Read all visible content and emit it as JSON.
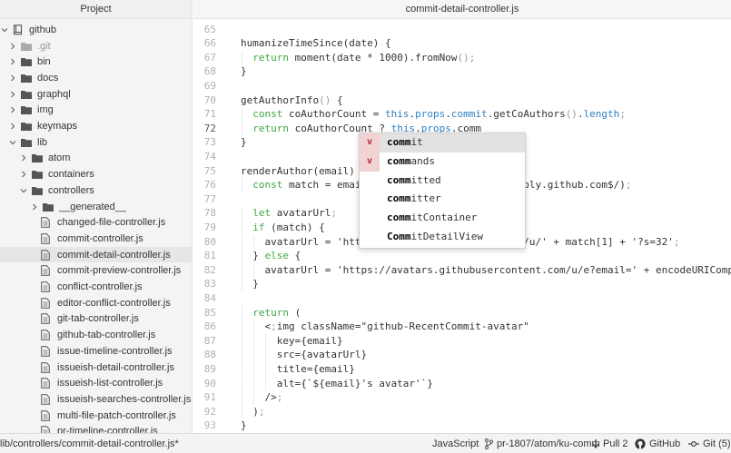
{
  "tree": {
    "header": "Project",
    "items": [
      {
        "label": "github",
        "kind": "repo",
        "open": true,
        "depth": 0
      },
      {
        "label": ".git",
        "kind": "folder",
        "open": false,
        "depth": 1,
        "dim": true
      },
      {
        "label": "bin",
        "kind": "folder",
        "open": false,
        "depth": 1
      },
      {
        "label": "docs",
        "kind": "folder",
        "open": false,
        "depth": 1
      },
      {
        "label": "graphql",
        "kind": "folder",
        "open": false,
        "depth": 1
      },
      {
        "label": "img",
        "kind": "folder",
        "open": false,
        "depth": 1
      },
      {
        "label": "keymaps",
        "kind": "folder",
        "open": false,
        "depth": 1
      },
      {
        "label": "lib",
        "kind": "folder",
        "open": true,
        "depth": 1
      },
      {
        "label": "atom",
        "kind": "folder",
        "open": false,
        "depth": 2
      },
      {
        "label": "containers",
        "kind": "folder",
        "open": false,
        "depth": 2
      },
      {
        "label": "controllers",
        "kind": "folder",
        "open": true,
        "depth": 2
      },
      {
        "label": "__generated__",
        "kind": "folder",
        "open": false,
        "depth": 3
      },
      {
        "label": "changed-file-controller.js",
        "kind": "file",
        "depth": 3
      },
      {
        "label": "commit-controller.js",
        "kind": "file",
        "depth": 3
      },
      {
        "label": "commit-detail-controller.js",
        "kind": "file",
        "depth": 3,
        "selected": true
      },
      {
        "label": "commit-preview-controller.js",
        "kind": "file",
        "depth": 3
      },
      {
        "label": "conflict-controller.js",
        "kind": "file",
        "depth": 3
      },
      {
        "label": "editor-conflict-controller.js",
        "kind": "file",
        "depth": 3
      },
      {
        "label": "git-tab-controller.js",
        "kind": "file",
        "depth": 3
      },
      {
        "label": "github-tab-controller.js",
        "kind": "file",
        "depth": 3
      },
      {
        "label": "issue-timeline-controller.js",
        "kind": "file",
        "depth": 3
      },
      {
        "label": "issueish-detail-controller.js",
        "kind": "file",
        "depth": 3
      },
      {
        "label": "issueish-list-controller.js",
        "kind": "file",
        "depth": 3
      },
      {
        "label": "issueish-searches-controller.js",
        "kind": "file",
        "depth": 3
      },
      {
        "label": "multi-file-patch-controller.js",
        "kind": "file",
        "depth": 3
      },
      {
        "label": "pr-timeline-controller.js",
        "kind": "file",
        "depth": 3
      }
    ]
  },
  "editor": {
    "tab_title": "commit-detail-controller.js",
    "cursor_line": "72",
    "lines": [
      {
        "n": "65",
        "code": ""
      },
      {
        "n": "66",
        "code": "humanizeTimeSince(date) {"
      },
      {
        "n": "67",
        "code": "  return moment(date * 1000).fromNow();"
      },
      {
        "n": "68",
        "code": "}"
      },
      {
        "n": "69",
        "code": ""
      },
      {
        "n": "70",
        "code": "getAuthorInfo() {"
      },
      {
        "n": "71",
        "code": "  const coAuthorCount = this.props.commit.getCoAuthors().length;"
      },
      {
        "n": "72",
        "code": "  return coAuthorCount ? this.props.comm"
      },
      {
        "n": "73",
        "code": "}"
      },
      {
        "n": "74",
        "code": ""
      },
      {
        "n": "75",
        "code": "renderAuthor(email) {"
      },
      {
        "n": "76",
        "code": "  const match = email                      noreply.github.com$/);"
      },
      {
        "n": "77",
        "code": ""
      },
      {
        "n": "78",
        "code": "  let avatarUrl;"
      },
      {
        "n": "79",
        "code": "  if (match) {"
      },
      {
        "n": "80",
        "code": "    avatarUrl = 'http                      .com/u/' + match[1] + '?s=32';"
      },
      {
        "n": "81",
        "code": "  } else {"
      },
      {
        "n": "82",
        "code": "    avatarUrl = 'https://avatars.githubusercontent.com/u/e?email=' + encodeURIComponent"
      },
      {
        "n": "83",
        "code": "  }"
      },
      {
        "n": "84",
        "code": ""
      },
      {
        "n": "85",
        "code": "  return ("
      },
      {
        "n": "86",
        "code": "    <img className=\"github-RecentCommit-avatar\""
      },
      {
        "n": "87",
        "code": "      key={email}"
      },
      {
        "n": "88",
        "code": "      src={avatarUrl}"
      },
      {
        "n": "89",
        "code": "      title={email}"
      },
      {
        "n": "90",
        "code": "      alt={`${email}'s avatar'`}"
      },
      {
        "n": "91",
        "code": "    />"
      },
      {
        "n": "92",
        "code": "  );"
      },
      {
        "n": "93",
        "code": "}"
      }
    ]
  },
  "autocomplete": {
    "typed": "comm",
    "items": [
      {
        "type": "v",
        "match": "comm",
        "rest": "it",
        "selected": true
      },
      {
        "type": "v",
        "match": "comm",
        "rest": "ands"
      },
      {
        "type": "",
        "match": "comm",
        "rest": "itted"
      },
      {
        "type": "",
        "match": "comm",
        "rest": "itter"
      },
      {
        "type": "",
        "match": "comm",
        "rest": "itContainer"
      },
      {
        "type": "",
        "match": "Comm",
        "rest": "itDetailView"
      }
    ]
  },
  "status_bar": {
    "file_path": "lib/controllers/commit-detail-controller.js*",
    "grammar": "JavaScript",
    "branch": "pr-1807/atom/ku-comm",
    "pull": "Pull 2",
    "github": "GitHub",
    "git": "Git (5)"
  },
  "colors": {
    "keyword": "#3fa842",
    "this": "#2f7fc1",
    "punct": "#999999",
    "ac_type": "#b3262c",
    "selected_row": "#e6e6e6"
  }
}
